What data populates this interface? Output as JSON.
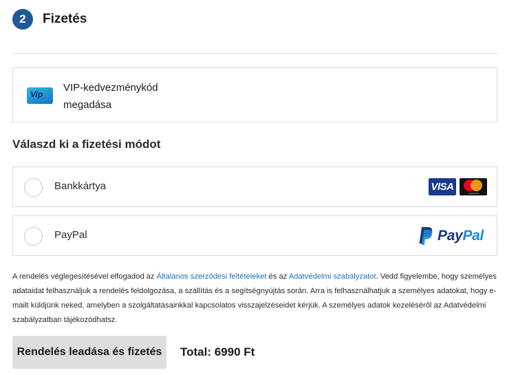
{
  "step": {
    "number": "2",
    "title": "Fizetés"
  },
  "vip": {
    "line1": "VIP-kedvezménykód",
    "line2": "megadása",
    "logo_text": "Vip",
    "logo_icon": "vip-logo-icon"
  },
  "payment": {
    "section_title": "Válaszd ki a fizetési módot",
    "options": [
      {
        "label": "Bankkártya",
        "icons": [
          "visa-icon",
          "mastercard-icon"
        ],
        "visa_text": "VISA",
        "mc_text": "mastercard"
      },
      {
        "label": "PayPal",
        "icons": [
          "paypal-icon"
        ],
        "logo_pay": "Pay",
        "logo_pal": "Pal"
      }
    ]
  },
  "legal": {
    "part1": "A rendelés véglegesítésével elfogadod az ",
    "link_terms": "Általános szerződési feltételeket",
    "part2": " és az ",
    "link_privacy": "Adatvédelmi szabályzatot",
    "part3": ". Vedd figyelembe, hogy személyes adataidat felhasználjuk a rendelés feldolgozása, a szállítás és a segítségnyújtás során. Arra is felhasználhatjuk a személyes adatokat, hogy e-mailt küldjünk neked, amelyben a szolgáltatásainkkal kapcsolatos visszajelzéseidet kérjük. A személyes adatok kezeléséről az Adatvédelmi szabályzatban tájékozódhatsz."
  },
  "footer": {
    "order_button": "Rendelés leadása és fizetés",
    "total": "Total: 6990 Ft"
  },
  "colors": {
    "accent": "#1f5a96",
    "link": "#1f6fb5",
    "button_bg": "#dedede",
    "border": "#d9d9d9"
  }
}
